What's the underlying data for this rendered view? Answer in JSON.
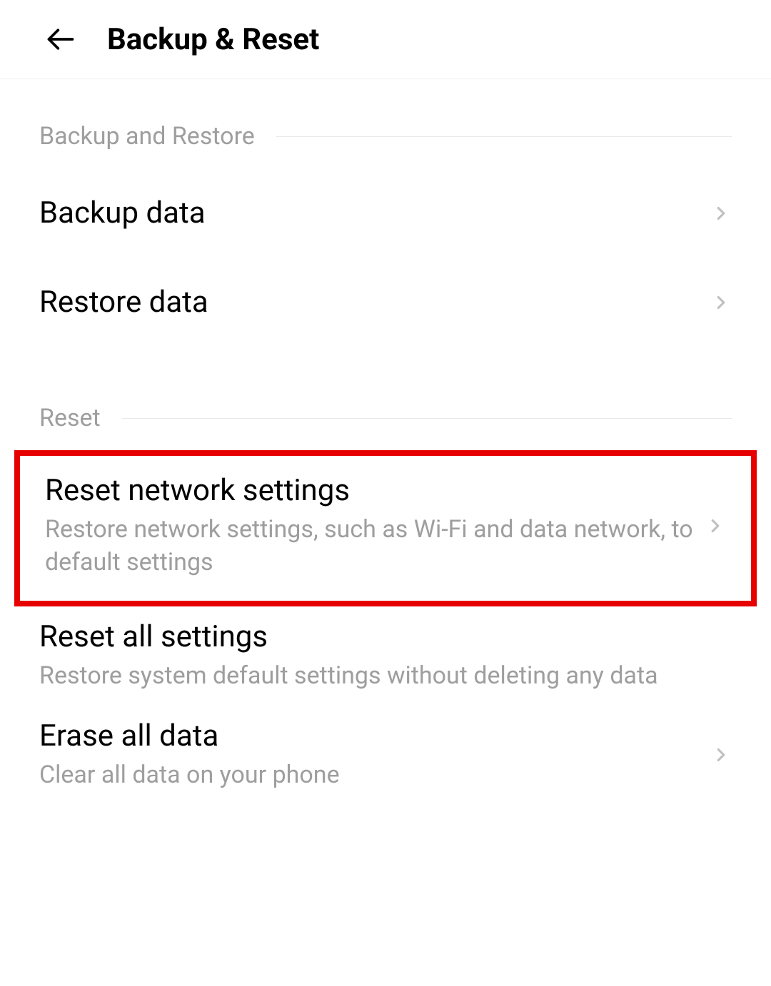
{
  "header": {
    "title": "Backup & Reset"
  },
  "sections": {
    "backup": {
      "title": "Backup and Restore",
      "items": [
        {
          "title": "Backup data"
        },
        {
          "title": "Restore data"
        }
      ]
    },
    "reset": {
      "title": "Reset",
      "items": [
        {
          "title": "Reset network settings",
          "subtitle": "Restore network settings, such as Wi-Fi and data network, to default settings"
        },
        {
          "title": "Reset all settings",
          "subtitle": "Restore system default settings without deleting any data"
        },
        {
          "title": "Erase all data",
          "subtitle": "Clear all data on your phone"
        }
      ]
    }
  }
}
